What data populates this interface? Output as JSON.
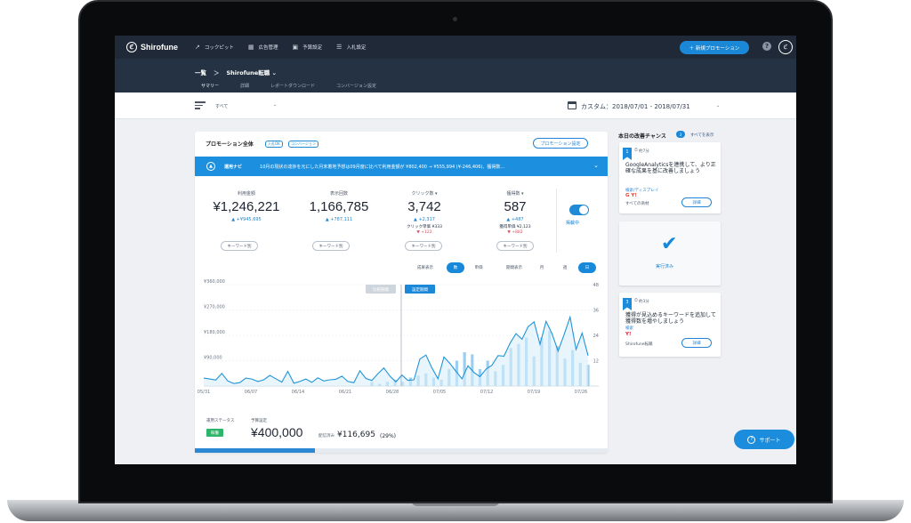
{
  "colors": {
    "accent": "#1a88d6",
    "nav": "#1f2937",
    "success": "#2fb56a"
  },
  "app": {
    "logo": "Shirofune",
    "logo_mark": "ℭ"
  },
  "nav": {
    "items": [
      {
        "label": "コックピット",
        "icon": "trend-icon"
      },
      {
        "label": "広告管理",
        "icon": "grid-icon"
      },
      {
        "label": "予算設定",
        "icon": "briefcase-icon"
      },
      {
        "label": "入札設定",
        "icon": "sliders-icon"
      }
    ],
    "cta": "＋ 新規プロモーション",
    "help": "?",
    "profile": "ℭ"
  },
  "breadcrumb": {
    "home": "一覧",
    "separator": "＞",
    "current": "Shirofune転職 ⌄"
  },
  "subtabs": [
    "サマリー",
    "詳細",
    "レポートダウンロード",
    "コンバージョン設定"
  ],
  "filter": {
    "value": "すべて",
    "caret": "⌄"
  },
  "date": {
    "text": "カスタム：2018/07/01 - 2018/07/31",
    "caret": "⌄"
  },
  "promo": {
    "title": "プロモーション全体",
    "chips": [
      "入札OK",
      "コンバージョン"
    ],
    "settings_button": "プロモーション設定",
    "ops": {
      "label": "運用ナビ",
      "icon": "arrow-up-icon",
      "message": "10月の現状の達捗を元にした月末着地予想は09月度に比べて利用金額が ¥802,400 → ¥555,994 (¥-246,406)、獲得数…",
      "chevron": "⌄"
    },
    "metrics": [
      {
        "label": "利用金額",
        "value": "¥1,246,221",
        "delta": "▲ +¥945,695",
        "sub1": "",
        "sub2": "",
        "btn": "キーワード別"
      },
      {
        "label": "表示回数",
        "value": "1,166,785",
        "delta": "▲ +787,111",
        "sub1": "",
        "sub2": "",
        "btn": "キーワード別"
      },
      {
        "label": "クリック数 ▾",
        "value": "3,742",
        "delta": "▲ +2,317",
        "sub1": "クリック単価 ¥333",
        "sub2": "▼ +122",
        "btn": "キーワード別"
      },
      {
        "label": "獲得数 ▾",
        "value": "587",
        "delta": "▲ +487",
        "sub1": "獲得単価 ¥2,123",
        "sub2": "▼ +882",
        "btn": "キーワード別"
      }
    ],
    "toggle_label": "掲載中",
    "period_controls": {
      "label1": "成果表示",
      "opt1": "数",
      "opt2": "単価",
      "label2": "期間表示",
      "opt3": "月",
      "opt4": "週",
      "opt5": "日"
    },
    "status": {
      "label": "運用ステータス",
      "value": "稼働"
    },
    "budget": {
      "label": "予算設定",
      "value": "¥400,000",
      "spent_label": "配信済み",
      "spent": "¥116,695",
      "pct": "(29%)",
      "progress": 0.29
    }
  },
  "chart_data": {
    "type": "line",
    "title": "",
    "x_ticks": [
      "05/31",
      "06/07",
      "06/14",
      "06/21",
      "06/28",
      "07/05",
      "07/12",
      "07/19",
      "07/26"
    ],
    "y_left_ticks": [
      "¥360,000",
      "¥270,000",
      "¥180,000",
      "¥90,000"
    ],
    "y_right_ticks": [
      48,
      36,
      24,
      12
    ],
    "ylim_left": [
      0,
      360000
    ],
    "ylim_right": [
      0,
      48
    ],
    "marker_labels": [
      "比較期間",
      "設定期間"
    ],
    "series": [
      {
        "values": [
          28000,
          25000,
          21000,
          45000,
          18000,
          9000,
          12000,
          28000,
          25000,
          16000,
          22000,
          38000,
          26000,
          14000,
          52000,
          10000,
          16000,
          25000,
          13000,
          29000,
          18000,
          22000,
          24000,
          35000,
          16000,
          12000,
          54000,
          27000,
          20000,
          44000,
          64000,
          35000,
          15000,
          39000,
          20000,
          22000,
          96000,
          110000,
          64000,
          26000,
          103000,
          80000,
          52000,
          26000,
          72000,
          48000,
          33000,
          60000,
          74000,
          108000,
          106000,
          152000,
          186000,
          166000,
          210000,
          228000,
          148000,
          230000,
          186000,
          124000,
          182000,
          245000,
          130000,
          188000,
          108000
        ]
      },
      {
        "values": [
          2,
          1,
          2,
          3,
          2,
          4,
          5,
          6,
          4,
          3,
          8,
          12,
          16,
          15,
          8,
          12,
          7,
          10,
          18,
          20,
          23,
          14,
          23,
          26,
          19,
          13,
          17,
          11,
          10
        ]
      }
    ]
  },
  "tips": {
    "title": "本日の改善チャンス",
    "count": "3",
    "all_link": "すべてを表示",
    "items": [
      {
        "num": "1",
        "time": "約7分",
        "headline": "GoogleAnalyticsを連携して、より正確な成果を基に改善しましょう",
        "cat": "検索/ディスプレイ",
        "logos": "G Y!",
        "scope": "すべての商材",
        "btn": "詳細"
      },
      {
        "done": "実行済み"
      },
      {
        "num": "3",
        "time": "約3分",
        "headline": "獲得が見込めるキーワードを追加して獲得数を増やしましょう",
        "cat": "検索",
        "logos": "Y!",
        "scope": "Shirofune転職",
        "btn": "詳細"
      }
    ]
  },
  "support": {
    "label": "サポート",
    "icon": "?"
  }
}
